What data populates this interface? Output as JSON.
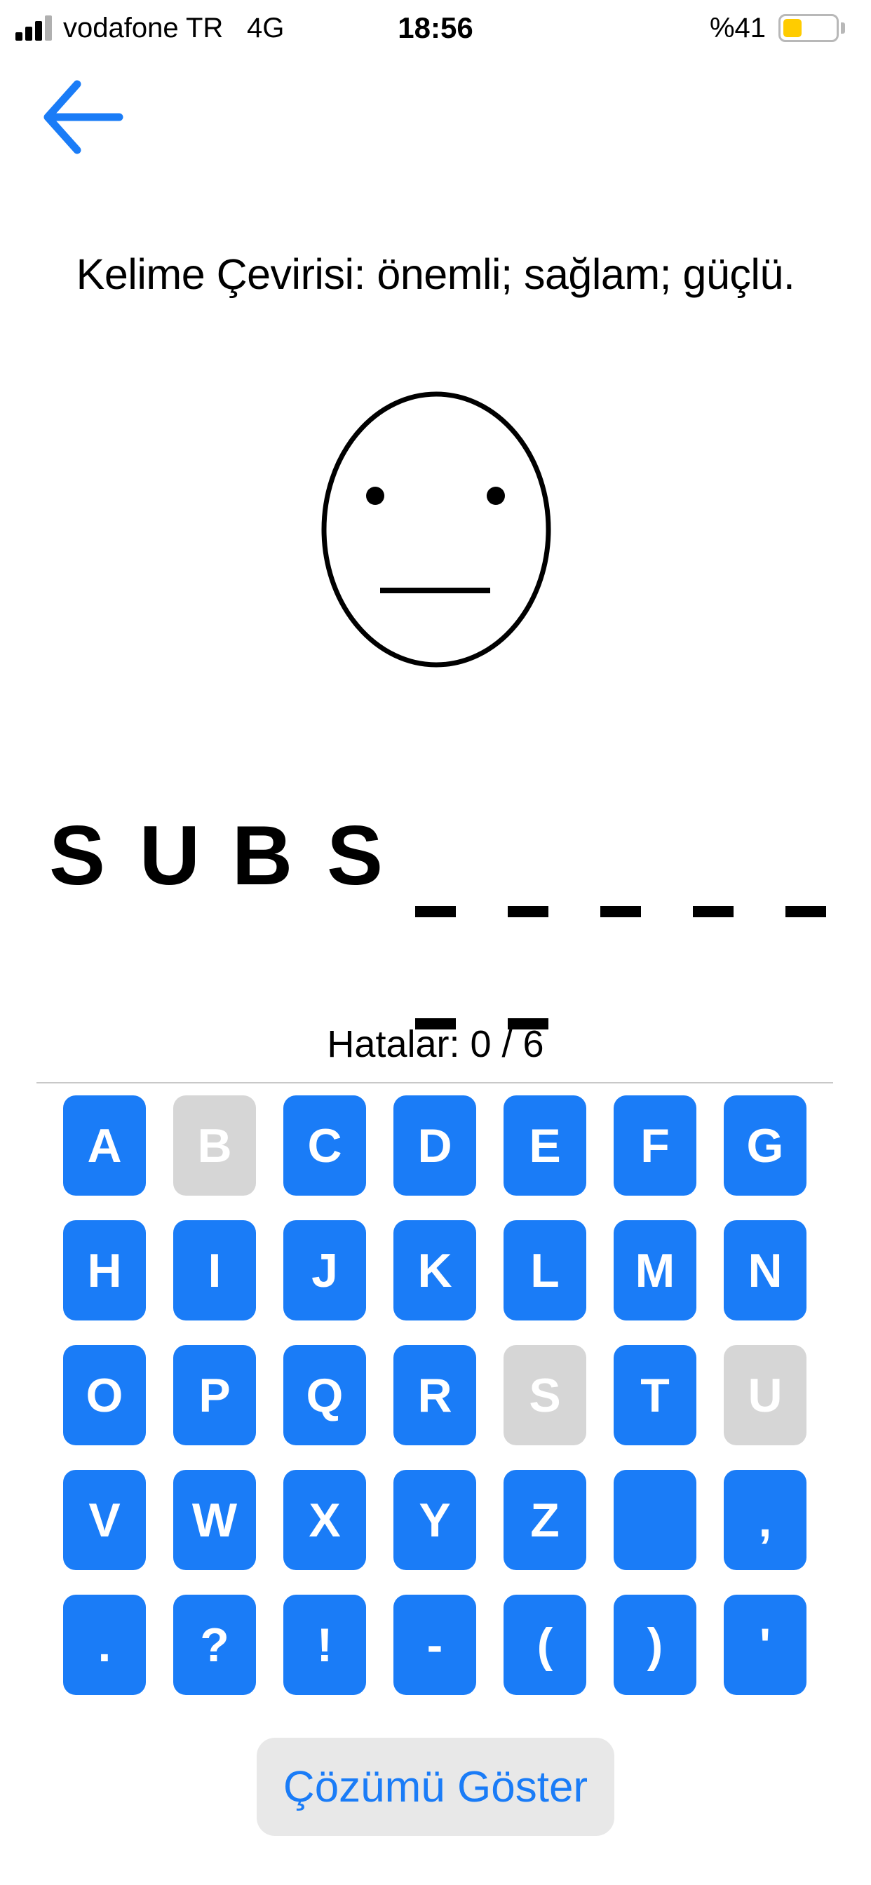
{
  "status_bar": {
    "carrier": "vodafone TR",
    "network": "4G",
    "time": "18:56",
    "battery_percent": "%41"
  },
  "nav": {
    "back_icon": "arrow-left-icon"
  },
  "game": {
    "translation": "Kelime Çevirisi: önemli; sağlam; güçlü.",
    "face_icon": "neutral-face-icon",
    "word_slots": [
      "S",
      "U",
      "B",
      "S",
      "",
      "",
      "",
      "",
      "",
      "",
      ""
    ],
    "errors_text": "Hatalar: 0 / 6"
  },
  "keyboard": {
    "accent_color": "#1a7cf7",
    "disabled_color": "#d6d6d6",
    "keys": [
      {
        "label": "A",
        "disabled": false
      },
      {
        "label": "B",
        "disabled": true
      },
      {
        "label": "C",
        "disabled": false
      },
      {
        "label": "D",
        "disabled": false
      },
      {
        "label": "E",
        "disabled": false
      },
      {
        "label": "F",
        "disabled": false
      },
      {
        "label": "G",
        "disabled": false
      },
      {
        "label": "H",
        "disabled": false
      },
      {
        "label": "I",
        "disabled": false
      },
      {
        "label": "J",
        "disabled": false
      },
      {
        "label": "K",
        "disabled": false
      },
      {
        "label": "L",
        "disabled": false
      },
      {
        "label": "M",
        "disabled": false
      },
      {
        "label": "N",
        "disabled": false
      },
      {
        "label": "O",
        "disabled": false
      },
      {
        "label": "P",
        "disabled": false
      },
      {
        "label": "Q",
        "disabled": false
      },
      {
        "label": "R",
        "disabled": false
      },
      {
        "label": "S",
        "disabled": true
      },
      {
        "label": "T",
        "disabled": false
      },
      {
        "label": "U",
        "disabled": true
      },
      {
        "label": "V",
        "disabled": false
      },
      {
        "label": "W",
        "disabled": false
      },
      {
        "label": "X",
        "disabled": false
      },
      {
        "label": "Y",
        "disabled": false
      },
      {
        "label": "Z",
        "disabled": false
      },
      {
        "label": "",
        "disabled": false
      },
      {
        "label": ",",
        "disabled": false
      },
      {
        "label": ".",
        "disabled": false
      },
      {
        "label": "?",
        "disabled": false
      },
      {
        "label": "!",
        "disabled": false
      },
      {
        "label": "-",
        "disabled": false
      },
      {
        "label": "(",
        "disabled": false
      },
      {
        "label": ")",
        "disabled": false
      },
      {
        "label": "'",
        "disabled": false
      }
    ]
  },
  "solution_button": {
    "label": "Çözümü Göster"
  }
}
